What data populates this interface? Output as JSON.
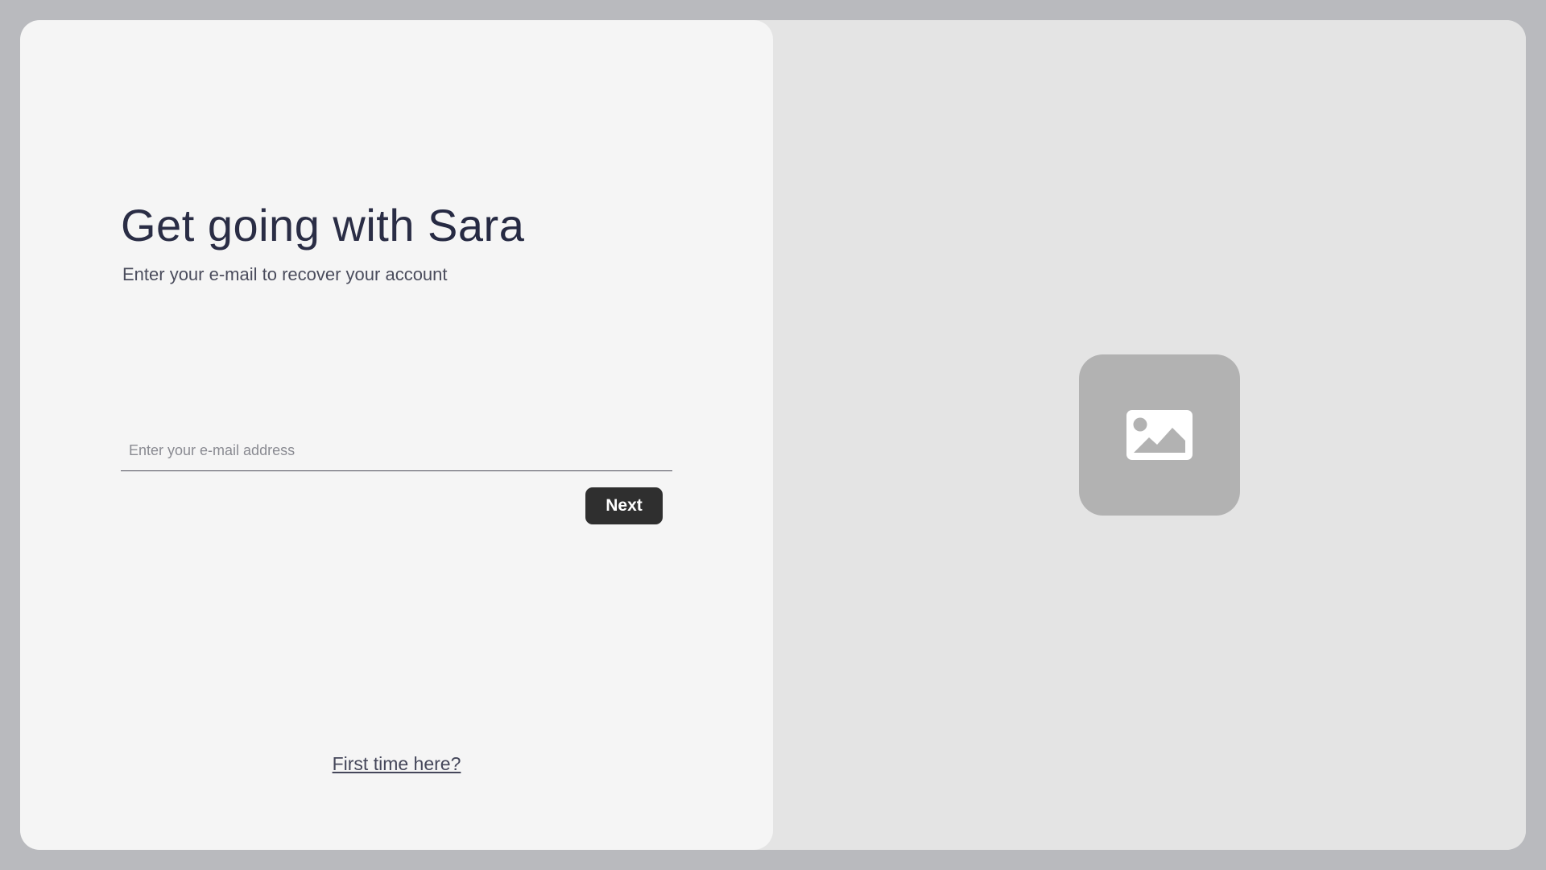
{
  "login": {
    "headline_prefix": "Get going with ",
    "brand_name": "Sara",
    "subtitle": "Enter your e-mail to recover your account",
    "email_placeholder": "Enter your e-mail address",
    "email_value": "",
    "next_label": "Next",
    "first_time_link": "First time here?"
  },
  "illustration": {
    "icon": "image-icon"
  },
  "colors": {
    "page_background": "#b9babe",
    "left_panel": "#f5f5f5",
    "right_panel": "#e4e4e4",
    "button": "#2f2f2f",
    "headline_text": "#2a2d45",
    "image_tile": "#b2b2b2"
  }
}
